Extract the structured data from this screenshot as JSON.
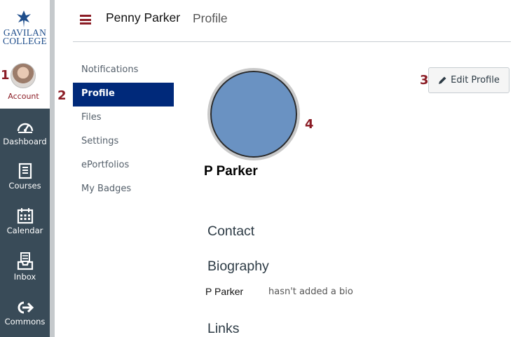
{
  "brand": {
    "line1": "GAVILAN",
    "line2": "COLLEGE",
    "color": "#1f4e8c"
  },
  "global_nav": {
    "account_label": "Account",
    "items": [
      {
        "label": "Dashboard",
        "icon": "dashboard-icon"
      },
      {
        "label": "Courses",
        "icon": "courses-icon"
      },
      {
        "label": "Calendar",
        "icon": "calendar-icon"
      },
      {
        "label": "Inbox",
        "icon": "inbox-icon"
      },
      {
        "label": "Commons",
        "icon": "commons-icon"
      }
    ],
    "background": "#394b58"
  },
  "header": {
    "user": "Penny Parker",
    "page": "Profile",
    "menu_icon": "hamburger-icon",
    "accent": "#8b1c25"
  },
  "account_menu": {
    "items": [
      "Notifications",
      "Profile",
      "Files",
      "Settings",
      "ePortfolios",
      "My Badges"
    ],
    "active": "Profile",
    "active_color": "#00297a"
  },
  "profile": {
    "display_name": "P Parker",
    "edit_button": "Edit Profile",
    "edit_icon": "pencil-icon",
    "sections": {
      "contact": "Contact",
      "biography": "Biography",
      "links": "Links"
    },
    "bio_name": "P Parker",
    "bio_text": "hasn't added a bio"
  },
  "annotations": [
    "1",
    "2",
    "3",
    "4"
  ]
}
